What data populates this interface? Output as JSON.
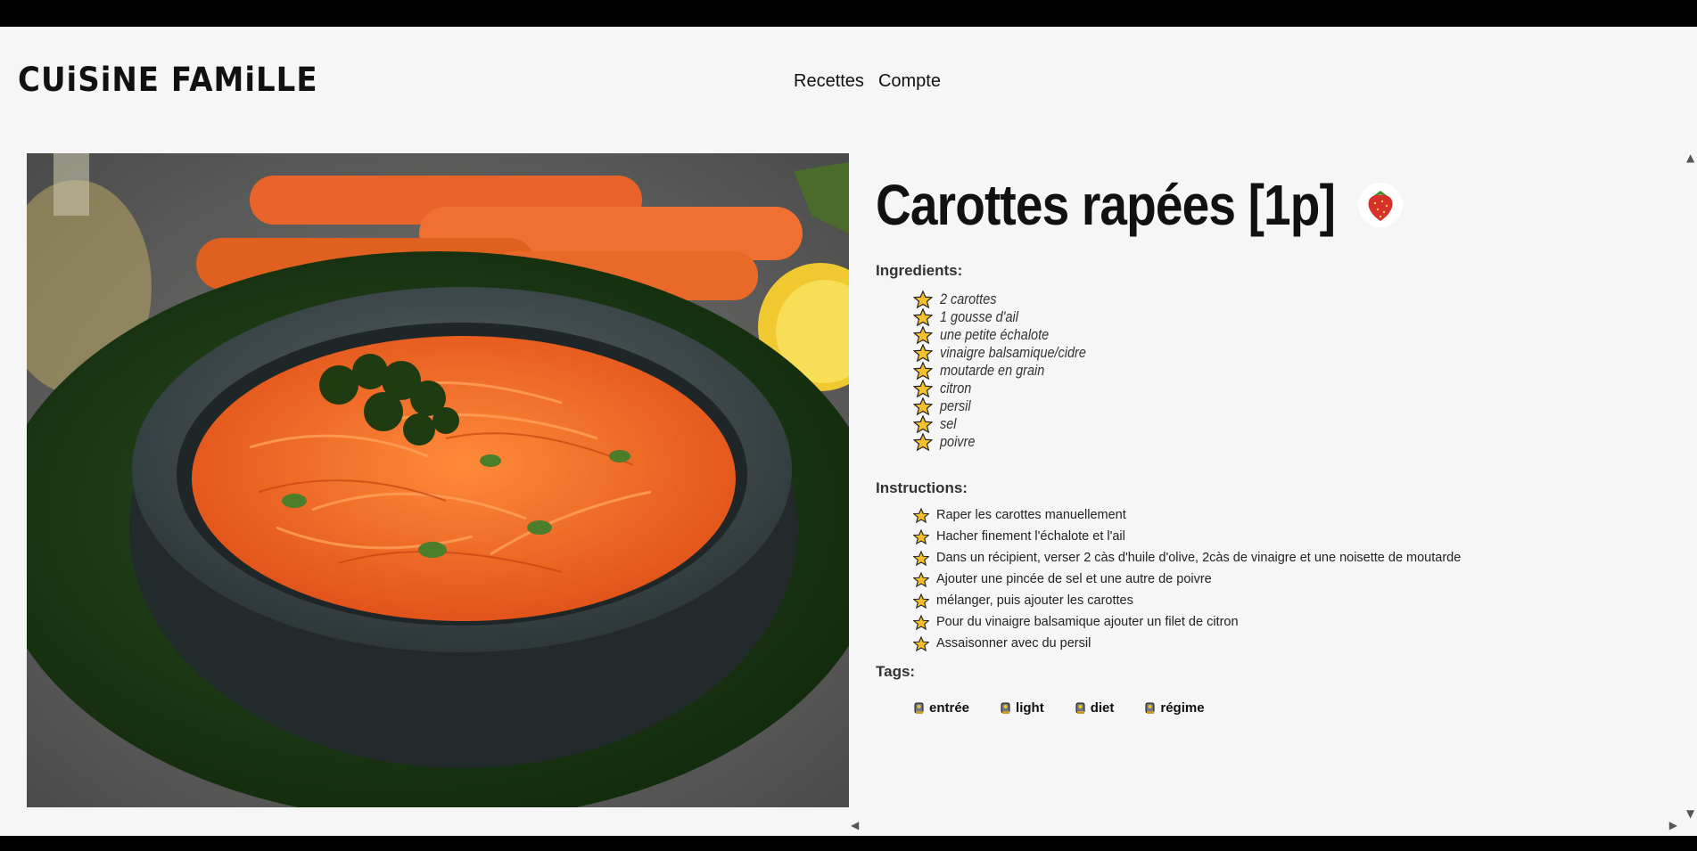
{
  "header": {
    "logo": "CUiSiNE FAMiLLE",
    "nav": [
      {
        "label": "Recettes"
      },
      {
        "label": "Compte"
      }
    ]
  },
  "recipe": {
    "title": "Carottes rapées [1p]",
    "badge_icon": "strawberry-icon",
    "ingredients_heading": "Ingredients:",
    "ingredients": [
      "2 carottes",
      "1 gousse d'ail",
      "une petite échalote",
      "vinaigre balsamique/cidre",
      "moutarde en grain",
      "citron",
      "persil",
      "sel",
      "poivre"
    ],
    "instructions_heading": "Instructions:",
    "instructions": [
      "Raper les carottes manuellement",
      "Hacher finement l'échalote et l'ail",
      "Dans un récipient, verser 2 càs d'huile d'olive, 2càs de vinaigre et une noisette de moutarde",
      "Ajouter une pincée de sel et une autre de poivre",
      "mélanger, puis ajouter les carottes",
      "Pour du vinaigre balsamique ajouter un filet de citron",
      "Assaisonner avec du persil"
    ],
    "tags_heading": "Tags:",
    "tags": [
      "entrée",
      "light",
      "diet",
      "régime"
    ]
  },
  "colors": {
    "background": "#f6f6f6",
    "star_fill": "#f5c02a",
    "star_stroke": "#222222",
    "carrot": "#f26b1d",
    "bowl": "#3e4a4c",
    "plate": "#1f3a17"
  }
}
